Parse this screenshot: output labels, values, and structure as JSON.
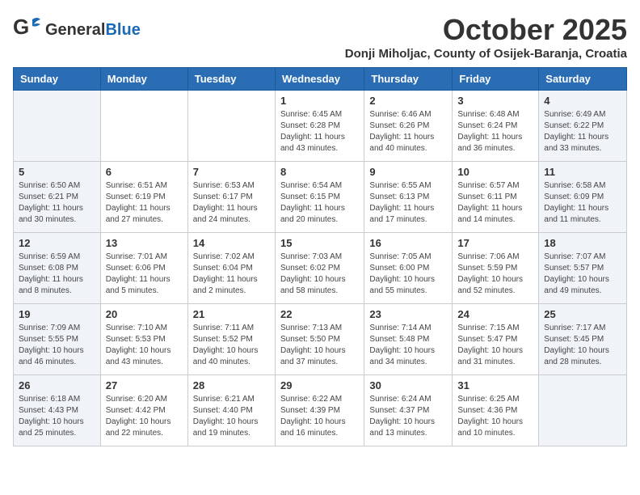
{
  "header": {
    "logo_general": "General",
    "logo_blue": "Blue",
    "month": "October 2025",
    "location": "Donji Miholjac, County of Osijek-Baranja, Croatia"
  },
  "days_of_week": [
    "Sunday",
    "Monday",
    "Tuesday",
    "Wednesday",
    "Thursday",
    "Friday",
    "Saturday"
  ],
  "weeks": [
    [
      {
        "day": "",
        "info": ""
      },
      {
        "day": "",
        "info": ""
      },
      {
        "day": "",
        "info": ""
      },
      {
        "day": "1",
        "info": "Sunrise: 6:45 AM\nSunset: 6:28 PM\nDaylight: 11 hours\nand 43 minutes."
      },
      {
        "day": "2",
        "info": "Sunrise: 6:46 AM\nSunset: 6:26 PM\nDaylight: 11 hours\nand 40 minutes."
      },
      {
        "day": "3",
        "info": "Sunrise: 6:48 AM\nSunset: 6:24 PM\nDaylight: 11 hours\nand 36 minutes."
      },
      {
        "day": "4",
        "info": "Sunrise: 6:49 AM\nSunset: 6:22 PM\nDaylight: 11 hours\nand 33 minutes."
      }
    ],
    [
      {
        "day": "5",
        "info": "Sunrise: 6:50 AM\nSunset: 6:21 PM\nDaylight: 11 hours\nand 30 minutes."
      },
      {
        "day": "6",
        "info": "Sunrise: 6:51 AM\nSunset: 6:19 PM\nDaylight: 11 hours\nand 27 minutes."
      },
      {
        "day": "7",
        "info": "Sunrise: 6:53 AM\nSunset: 6:17 PM\nDaylight: 11 hours\nand 24 minutes."
      },
      {
        "day": "8",
        "info": "Sunrise: 6:54 AM\nSunset: 6:15 PM\nDaylight: 11 hours\nand 20 minutes."
      },
      {
        "day": "9",
        "info": "Sunrise: 6:55 AM\nSunset: 6:13 PM\nDaylight: 11 hours\nand 17 minutes."
      },
      {
        "day": "10",
        "info": "Sunrise: 6:57 AM\nSunset: 6:11 PM\nDaylight: 11 hours\nand 14 minutes."
      },
      {
        "day": "11",
        "info": "Sunrise: 6:58 AM\nSunset: 6:09 PM\nDaylight: 11 hours\nand 11 minutes."
      }
    ],
    [
      {
        "day": "12",
        "info": "Sunrise: 6:59 AM\nSunset: 6:08 PM\nDaylight: 11 hours\nand 8 minutes."
      },
      {
        "day": "13",
        "info": "Sunrise: 7:01 AM\nSunset: 6:06 PM\nDaylight: 11 hours\nand 5 minutes."
      },
      {
        "day": "14",
        "info": "Sunrise: 7:02 AM\nSunset: 6:04 PM\nDaylight: 11 hours\nand 2 minutes."
      },
      {
        "day": "15",
        "info": "Sunrise: 7:03 AM\nSunset: 6:02 PM\nDaylight: 10 hours\nand 58 minutes."
      },
      {
        "day": "16",
        "info": "Sunrise: 7:05 AM\nSunset: 6:00 PM\nDaylight: 10 hours\nand 55 minutes."
      },
      {
        "day": "17",
        "info": "Sunrise: 7:06 AM\nSunset: 5:59 PM\nDaylight: 10 hours\nand 52 minutes."
      },
      {
        "day": "18",
        "info": "Sunrise: 7:07 AM\nSunset: 5:57 PM\nDaylight: 10 hours\nand 49 minutes."
      }
    ],
    [
      {
        "day": "19",
        "info": "Sunrise: 7:09 AM\nSunset: 5:55 PM\nDaylight: 10 hours\nand 46 minutes."
      },
      {
        "day": "20",
        "info": "Sunrise: 7:10 AM\nSunset: 5:53 PM\nDaylight: 10 hours\nand 43 minutes."
      },
      {
        "day": "21",
        "info": "Sunrise: 7:11 AM\nSunset: 5:52 PM\nDaylight: 10 hours\nand 40 minutes."
      },
      {
        "day": "22",
        "info": "Sunrise: 7:13 AM\nSunset: 5:50 PM\nDaylight: 10 hours\nand 37 minutes."
      },
      {
        "day": "23",
        "info": "Sunrise: 7:14 AM\nSunset: 5:48 PM\nDaylight: 10 hours\nand 34 minutes."
      },
      {
        "day": "24",
        "info": "Sunrise: 7:15 AM\nSunset: 5:47 PM\nDaylight: 10 hours\nand 31 minutes."
      },
      {
        "day": "25",
        "info": "Sunrise: 7:17 AM\nSunset: 5:45 PM\nDaylight: 10 hours\nand 28 minutes."
      }
    ],
    [
      {
        "day": "26",
        "info": "Sunrise: 6:18 AM\nSunset: 4:43 PM\nDaylight: 10 hours\nand 25 minutes."
      },
      {
        "day": "27",
        "info": "Sunrise: 6:20 AM\nSunset: 4:42 PM\nDaylight: 10 hours\nand 22 minutes."
      },
      {
        "day": "28",
        "info": "Sunrise: 6:21 AM\nSunset: 4:40 PM\nDaylight: 10 hours\nand 19 minutes."
      },
      {
        "day": "29",
        "info": "Sunrise: 6:22 AM\nSunset: 4:39 PM\nDaylight: 10 hours\nand 16 minutes."
      },
      {
        "day": "30",
        "info": "Sunrise: 6:24 AM\nSunset: 4:37 PM\nDaylight: 10 hours\nand 13 minutes."
      },
      {
        "day": "31",
        "info": "Sunrise: 6:25 AM\nSunset: 4:36 PM\nDaylight: 10 hours\nand 10 minutes."
      },
      {
        "day": "",
        "info": ""
      }
    ]
  ]
}
